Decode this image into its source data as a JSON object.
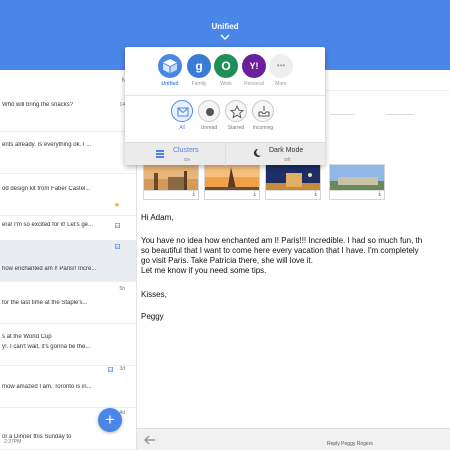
{
  "header": {
    "title": "Unified"
  },
  "list": {
    "col_label": "N",
    "items": [
      {
        "line1": "Who will bring the snacks?",
        "line2": "",
        "date": "14",
        "icon": "",
        "selected": false
      },
      {
        "line1": "ents already. Is everything ok. I ...",
        "line2": "",
        "date": "",
        "icon": "",
        "selected": false
      },
      {
        "line1": "od design kit from Faber Castel...",
        "line2": "",
        "date": "",
        "icon": "star",
        "selected": false
      },
      {
        "line1": "era! I'm so excited for it! Let's ge...",
        "line2": "",
        "date": "",
        "icon": "image",
        "selected": false
      },
      {
        "line1": "how enchanted am I! Paris!! Incre...",
        "line2": "",
        "date": "",
        "icon": "image",
        "selected": true
      },
      {
        "line1": "for the last time at the Staple's...",
        "line2": "",
        "date": "5h",
        "icon": "",
        "selected": false
      },
      {
        "line1": "s at the World Cup",
        "line2": "y!. I can't wait, it's gonna be the...",
        "date": "",
        "icon": "",
        "selected": false
      },
      {
        "line1": "mow amazed I am. Toronto is in...",
        "line2": "",
        "date": "3d",
        "icon": "image",
        "selected": false
      },
      {
        "line1": "or a Dinner this Sunday to",
        "line2": "",
        "date": "4d",
        "icon": "",
        "selected": false
      }
    ],
    "bottom_time": "2:37PM"
  },
  "popup": {
    "accounts": [
      {
        "label": "Unified",
        "glyph": "",
        "color": "#4a86e8",
        "active": true
      },
      {
        "label": "Family",
        "glyph": "g",
        "color": "#3a7bd5",
        "active": false
      },
      {
        "label": "Work",
        "glyph": "O",
        "color": "#1f8f5a",
        "active": false
      },
      {
        "label": "Personal",
        "glyph": "Y!",
        "color": "#6b1f9c",
        "active": false
      },
      {
        "label": "More",
        "glyph": "•••",
        "color": "#e4e4e4",
        "active": false
      }
    ],
    "filters": [
      {
        "label": "All",
        "active": true
      },
      {
        "label": "Unread",
        "active": false
      },
      {
        "label": "Starred",
        "active": false
      },
      {
        "label": "Incoming",
        "active": false
      }
    ],
    "clusters": {
      "title": "Clusters",
      "sub": "On"
    },
    "dark_mode": {
      "title": "Dark Mode",
      "sub": "Off"
    }
  },
  "email": {
    "greeting": "Hi Adam,",
    "body_lines": [
      "You have no idea how enchanted am I! Paris!!! Incredible. I had so much fun, th",
      "so beautiful that I want to come here every vacation that I have. I'm completely",
      "go visit Paris. Take Patricia there, she will love it.",
      "Let me know if you need some tips."
    ],
    "closing": "Kisses,",
    "signature": "Peggy"
  },
  "bottombar": {
    "reply": "Reply Peggy Rogers"
  },
  "colors": {
    "accent": "#4a86e8",
    "selected_row": "#e9edf2",
    "star": "#e8b21d"
  }
}
